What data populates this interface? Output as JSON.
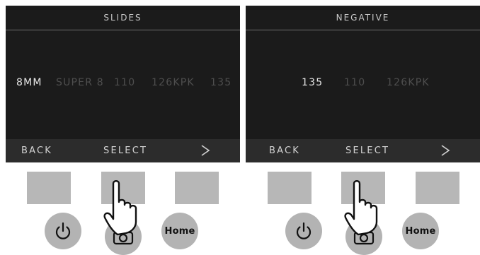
{
  "screens": [
    {
      "title": "SLIDES",
      "options": [
        "8MM",
        "SUPER 8",
        "110",
        "126KPK",
        "135"
      ],
      "selected_index": 0,
      "bottom": {
        "back": "BACK",
        "select": "SELECT",
        "next": ">"
      }
    },
    {
      "title": "NEGATIVE",
      "options": [
        "135",
        "110",
        "126KPK"
      ],
      "selected_index": 0,
      "bottom": {
        "back": "BACK",
        "select": "SELECT",
        "next": ">"
      }
    }
  ],
  "controls": {
    "home_label": "Home",
    "icons": [
      "power-icon",
      "camera-icon",
      "pointing-hand-icon"
    ]
  },
  "colors": {
    "screen_bg": "#1b1b1b",
    "bottom_bar_bg": "#2c2c2c",
    "option_selected": "#e6e6e6",
    "option_dim": "#4e4e4e",
    "hardware_gray": "#b7b7b7"
  }
}
